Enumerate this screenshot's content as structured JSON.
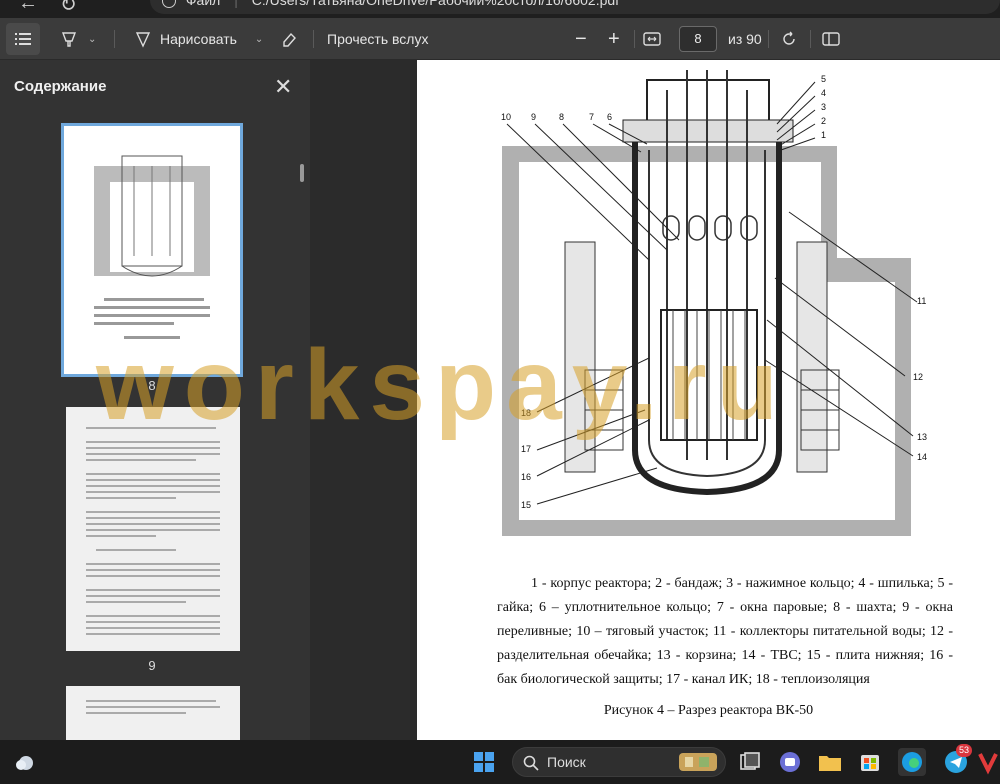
{
  "address_bar": {
    "label": "Файл",
    "path": "C:/Users/Татьяна/OneDrive/Рабочий%20стол/16/6602.pdf"
  },
  "toolbar": {
    "draw_label": "Нарисовать",
    "read_aloud_label": "Прочесть вслух",
    "zoom_out": "−",
    "zoom_in": "+",
    "current_page": "8",
    "total_pages": "из 90"
  },
  "sidebar": {
    "title": "Содержание",
    "pages": [
      {
        "number": "8"
      },
      {
        "number": "9"
      }
    ]
  },
  "document": {
    "figure_labels": [
      "1",
      "2",
      "3",
      "4",
      "5",
      "6",
      "7",
      "8",
      "9",
      "10",
      "11",
      "12",
      "13",
      "14",
      "15",
      "16",
      "17",
      "18"
    ],
    "caption": "1 - корпус реактора; 2 - бандаж; 3 - нажимное кольцо; 4 - шпилька; 5 - гайка; 6 – уплотнительное кольцо; 7 - окна паровые; 8 - шахта; 9 - окна переливные; 10 – тяговый участок; 11 - коллекторы питательной воды; 12 - разделительная обечайка; 13 - корзина; 14 - ТВС; 15 - плита нижняя; 16 - бак биологической защиты; 17 - канал ИК; 18 - теплоизоляция",
    "figure_title": "Рисунок 4 – Разрез реактора ВК-50"
  },
  "watermark": "workspay.ru",
  "taskbar": {
    "search_label": "Поиск",
    "notification_count": "53"
  },
  "colors": {
    "toolbar": "#3b3b3b",
    "sidebar": "#333333",
    "selection": "#6fa8dc",
    "watermark": "#d7a028"
  }
}
